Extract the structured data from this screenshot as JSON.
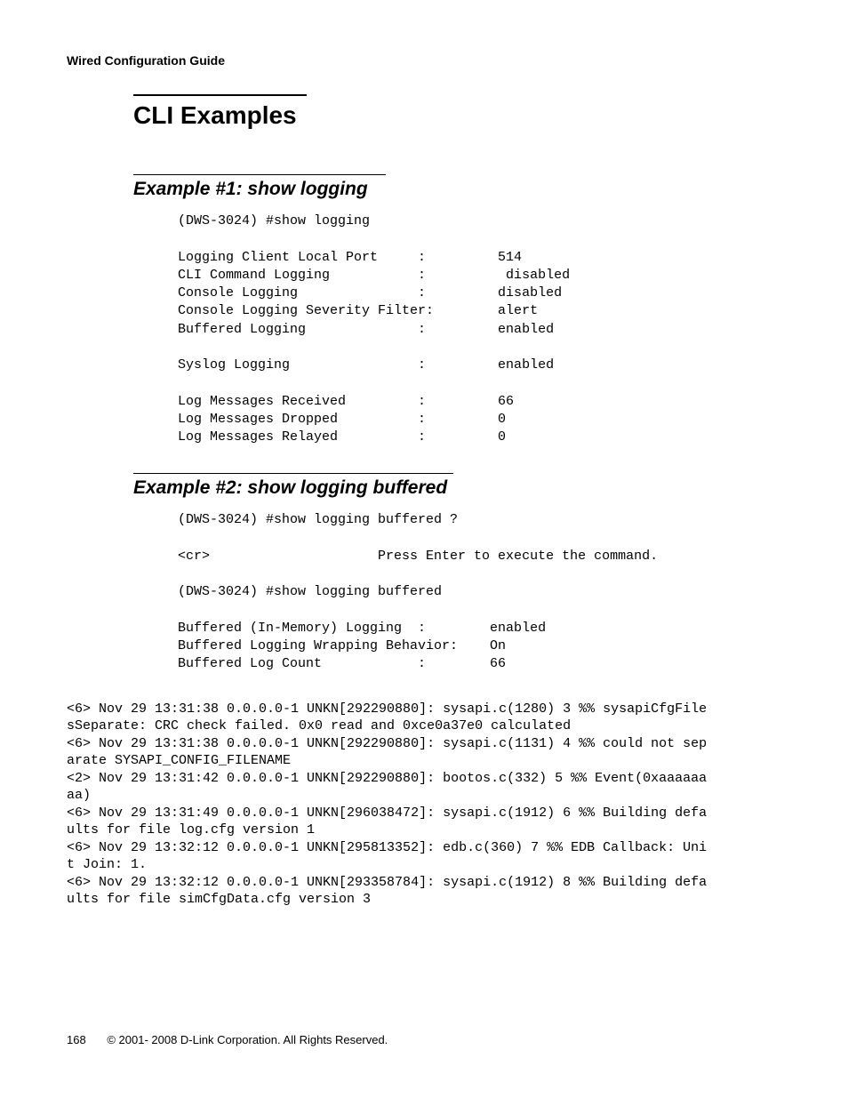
{
  "header": {
    "title": "Wired Configuration Guide"
  },
  "chapter": {
    "heading": "CLI Examples"
  },
  "example1": {
    "heading": "Example #1: show logging",
    "content": "(DWS-3024) #show logging\n\nLogging Client Local Port     :         514\nCLI Command Logging           :          disabled\nConsole Logging               :         disabled\nConsole Logging Severity Filter:        alert\nBuffered Logging              :         enabled\n\nSyslog Logging                :         enabled\n\nLog Messages Received         :         66\nLog Messages Dropped          :         0\nLog Messages Relayed          :         0"
  },
  "example2": {
    "heading": "Example #2: show logging buffered",
    "content": "(DWS-3024) #show logging buffered ?\n\n<cr>                     Press Enter to execute the command.\n\n(DWS-3024) #show logging buffered\n\nBuffered (In-Memory) Logging  :        enabled\nBuffered Logging Wrapping Behavior:    On\nBuffered Log Count            :        66"
  },
  "log": {
    "content": "<6> Nov 29 13:31:38 0.0.0.0-1 UNKN[292290880]: sysapi.c(1280) 3 %% sysapiCfgFile\nsSeparate: CRC check failed. 0x0 read and 0xce0a37e0 calculated\n<6> Nov 29 13:31:38 0.0.0.0-1 UNKN[292290880]: sysapi.c(1131) 4 %% could not sep\narate SYSAPI_CONFIG_FILENAME\n<2> Nov 29 13:31:42 0.0.0.0-1 UNKN[292290880]: bootos.c(332) 5 %% Event(0xaaaaaa\naa)\n<6> Nov 29 13:31:49 0.0.0.0-1 UNKN[296038472]: sysapi.c(1912) 6 %% Building defa\nults for file log.cfg version 1\n<6> Nov 29 13:32:12 0.0.0.0-1 UNKN[295813352]: edb.c(360) 7 %% EDB Callback: Uni\nt Join: 1.\n<6> Nov 29 13:32:12 0.0.0.0-1 UNKN[293358784]: sysapi.c(1912) 8 %% Building defa\nults for file simCfgData.cfg version 3"
  },
  "footer": {
    "page_number": "168",
    "copyright": "© 2001- 2008 D-Link Corporation. All Rights Reserved."
  }
}
